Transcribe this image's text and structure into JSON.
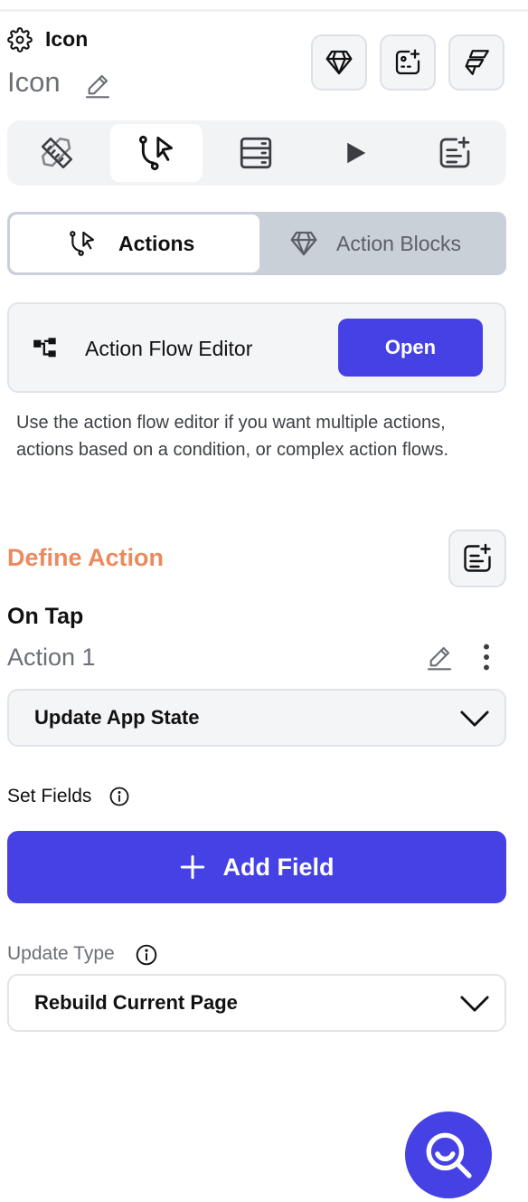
{
  "header": {
    "title": "Icon",
    "widget_name": "Icon",
    "settings_icon": "gear-icon",
    "edit_icon": "pencil-icon",
    "buttons": [
      {
        "name": "gem-button",
        "icon": "gem-icon"
      },
      {
        "name": "add-widget-button",
        "icon": "add-widget-icon"
      },
      {
        "name": "flutterflow-button",
        "icon": "flutterflow-logo-icon"
      }
    ]
  },
  "tabs": [
    {
      "name": "tab-properties",
      "icon": "ruler-pencil-icon",
      "active": false
    },
    {
      "name": "tab-actions",
      "icon": "flow-cursor-icon",
      "active": true
    },
    {
      "name": "tab-backend-query",
      "icon": "server-icon",
      "active": false
    },
    {
      "name": "tab-animations",
      "icon": "play-icon",
      "active": false
    },
    {
      "name": "tab-add-doc",
      "icon": "doc-add-icon",
      "active": false
    }
  ],
  "segmented": {
    "actions_label": "Actions",
    "action_blocks_label": "Action Blocks"
  },
  "action_flow": {
    "title": "Action Flow Editor",
    "open_label": "Open",
    "description": "Use the action flow editor if you want multiple actions, actions based on a condition, or complex action flows."
  },
  "define_action": {
    "title": "Define Action",
    "trigger": "On Tap",
    "action_name": "Action 1",
    "action_type": "Update App State"
  },
  "set_fields": {
    "label": "Set Fields",
    "add_label": "Add Field"
  },
  "update_type": {
    "label": "Update Type",
    "value": "Rebuild Current Page"
  },
  "colors": {
    "primary": "#4541e5",
    "accent": "#ec8a5e",
    "muted_text": "#6b6f76",
    "panel_bg": "#f4f5f7",
    "segment_bg": "#c9d0d8"
  }
}
